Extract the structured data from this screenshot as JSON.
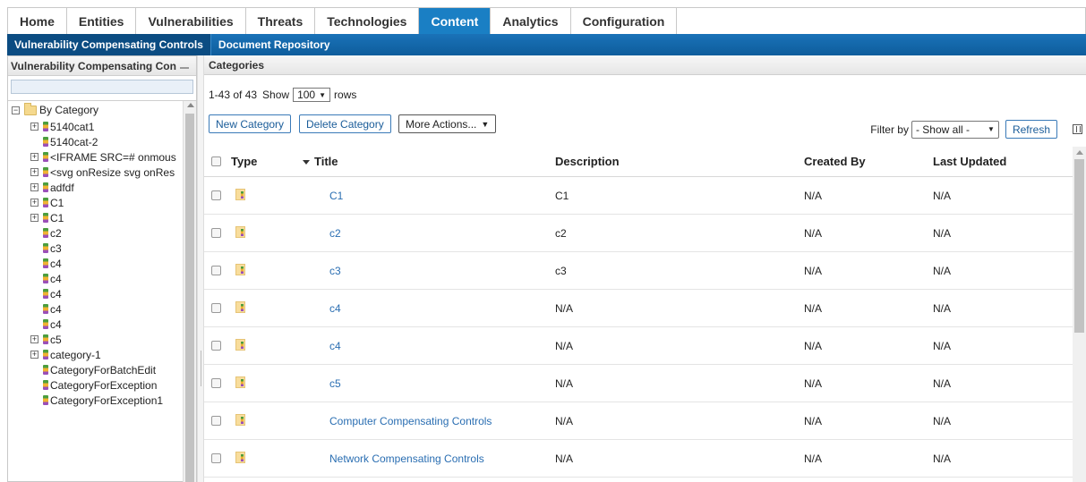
{
  "top_tabs": [
    {
      "label": "Home",
      "active": false
    },
    {
      "label": "Entities",
      "active": false
    },
    {
      "label": "Vulnerabilities",
      "active": false
    },
    {
      "label": "Threats",
      "active": false
    },
    {
      "label": "Technologies",
      "active": false
    },
    {
      "label": "Content",
      "active": true
    },
    {
      "label": "Analytics",
      "active": false
    },
    {
      "label": "Configuration",
      "active": false
    }
  ],
  "sub_tabs": [
    {
      "label": "Vulnerability Compensating Controls",
      "active": true
    },
    {
      "label": "Document Repository",
      "active": false
    }
  ],
  "left_panel": {
    "title": "Vulnerability Compensating Con",
    "tree": [
      {
        "label": "By Category",
        "level": 0,
        "expander": "−",
        "icon": "folder-icon"
      },
      {
        "label": "5140cat1",
        "level": 1,
        "expander": "+",
        "icon": "category-icon"
      },
      {
        "label": "5140cat-2",
        "level": 1,
        "expander": "",
        "icon": "category-icon"
      },
      {
        "label": "<IFRAME SRC=# onmous",
        "level": 1,
        "expander": "+",
        "icon": "category-icon"
      },
      {
        "label": "<svg onResize svg onRes",
        "level": 1,
        "expander": "+",
        "icon": "category-icon"
      },
      {
        "label": "adfdf",
        "level": 1,
        "expander": "+",
        "icon": "category-icon"
      },
      {
        "label": "C1",
        "level": 1,
        "expander": "+",
        "icon": "category-icon"
      },
      {
        "label": "C1",
        "level": 1,
        "expander": "+",
        "icon": "category-icon"
      },
      {
        "label": "c2",
        "level": 1,
        "expander": "",
        "icon": "category-icon"
      },
      {
        "label": "c3",
        "level": 1,
        "expander": "",
        "icon": "category-icon"
      },
      {
        "label": "c4",
        "level": 1,
        "expander": "",
        "icon": "category-icon"
      },
      {
        "label": "c4",
        "level": 1,
        "expander": "",
        "icon": "category-icon"
      },
      {
        "label": "c4",
        "level": 1,
        "expander": "",
        "icon": "category-icon"
      },
      {
        "label": "c4",
        "level": 1,
        "expander": "",
        "icon": "category-icon"
      },
      {
        "label": "c4",
        "level": 1,
        "expander": "",
        "icon": "category-icon"
      },
      {
        "label": "c5",
        "level": 1,
        "expander": "+",
        "icon": "category-icon"
      },
      {
        "label": "category-1",
        "level": 1,
        "expander": "+",
        "icon": "category-icon"
      },
      {
        "label": "CategoryForBatchEdit",
        "level": 1,
        "expander": "",
        "icon": "category-icon"
      },
      {
        "label": "CategoryForException",
        "level": 1,
        "expander": "",
        "icon": "category-icon"
      },
      {
        "label": "CategoryForException1",
        "level": 1,
        "expander": "",
        "icon": "category-icon"
      }
    ]
  },
  "right_panel": {
    "title": "Categories",
    "pager": {
      "range": "1-43 of 43",
      "show_label": "Show",
      "page_size": "100",
      "rows_label": "rows"
    },
    "buttons": {
      "new_category": "New Category",
      "delete_category": "Delete Category",
      "more_actions": "More Actions..."
    },
    "filter": {
      "label": "Filter by",
      "value": "- Show all -",
      "refresh": "Refresh"
    },
    "columns": {
      "type": "Type",
      "title": "Title",
      "description": "Description",
      "created_by": "Created By",
      "last_updated": "Last Updated"
    },
    "rows": [
      {
        "title": "C1",
        "description": "C1",
        "created_by": "N/A",
        "last_updated": "N/A"
      },
      {
        "title": "c2",
        "description": "c2",
        "created_by": "N/A",
        "last_updated": "N/A"
      },
      {
        "title": "c3",
        "description": "c3",
        "created_by": "N/A",
        "last_updated": "N/A"
      },
      {
        "title": "c4",
        "description": "N/A",
        "created_by": "N/A",
        "last_updated": "N/A"
      },
      {
        "title": "c4",
        "description": "N/A",
        "created_by": "N/A",
        "last_updated": "N/A"
      },
      {
        "title": "c5",
        "description": "N/A",
        "created_by": "N/A",
        "last_updated": "N/A"
      },
      {
        "title": "Computer Compensating Controls",
        "description": "N/A",
        "created_by": "N/A",
        "last_updated": "N/A"
      },
      {
        "title": "Network Compensating Controls",
        "description": "N/A",
        "created_by": "N/A",
        "last_updated": "N/A"
      }
    ]
  },
  "colors": {
    "accent": "#1a7fc4",
    "subnav": "#0e5d9c",
    "link": "#2a6eb2"
  }
}
